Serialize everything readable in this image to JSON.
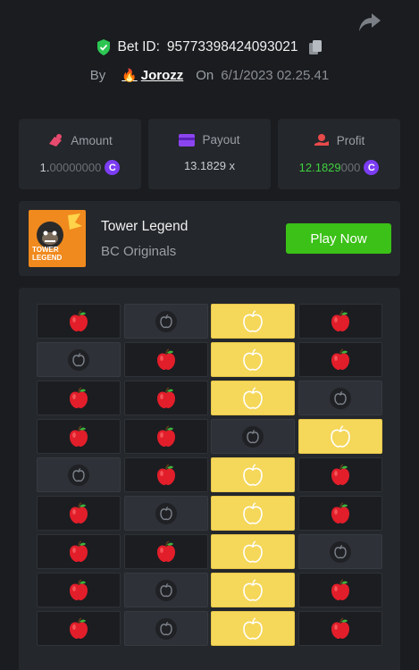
{
  "header": {
    "bet_label": "Bet ID:",
    "bet_id": "95773398424093021",
    "by_label": "By",
    "username": "Jorozz",
    "on_label": "On",
    "datetime": "6/1/2023 02.25.41"
  },
  "stats": {
    "amount": {
      "label": "Amount",
      "value_main": "1.",
      "value_dim": "00000000"
    },
    "payout": {
      "label": "Payout",
      "value": "13.1829 x"
    },
    "profit": {
      "label": "Profit",
      "value_green": "12.1829",
      "value_dim": "000"
    },
    "coin_symbol": "C"
  },
  "game": {
    "thumb_text": "TOWER LEGEND",
    "title": "Tower Legend",
    "subtitle": "BC Originals",
    "play_label": "Play Now"
  },
  "board": {
    "rows": [
      [
        "apple",
        "bad",
        "gold",
        "apple"
      ],
      [
        "bad",
        "apple",
        "gold",
        "apple"
      ],
      [
        "apple",
        "apple",
        "gold",
        "bad"
      ],
      [
        "apple",
        "apple",
        "bad",
        "gold"
      ],
      [
        "bad",
        "apple",
        "gold",
        "apple"
      ],
      [
        "apple",
        "bad",
        "gold",
        "apple"
      ],
      [
        "apple",
        "apple",
        "gold",
        "bad"
      ],
      [
        "apple",
        "bad",
        "gold",
        "apple"
      ],
      [
        "apple",
        "bad",
        "gold",
        "apple"
      ]
    ]
  },
  "colors": {
    "accent_green": "#3bc117",
    "profit_green": "#3fd13f",
    "coin_purple": "#7b3cf2",
    "gold_tile": "#f5d75a"
  },
  "icons": {
    "share": "share-icon",
    "verified": "shield-check-icon",
    "copy": "copy-icon",
    "amount": "amount-icon",
    "payout": "wallet-icon",
    "profit": "profit-icon"
  }
}
